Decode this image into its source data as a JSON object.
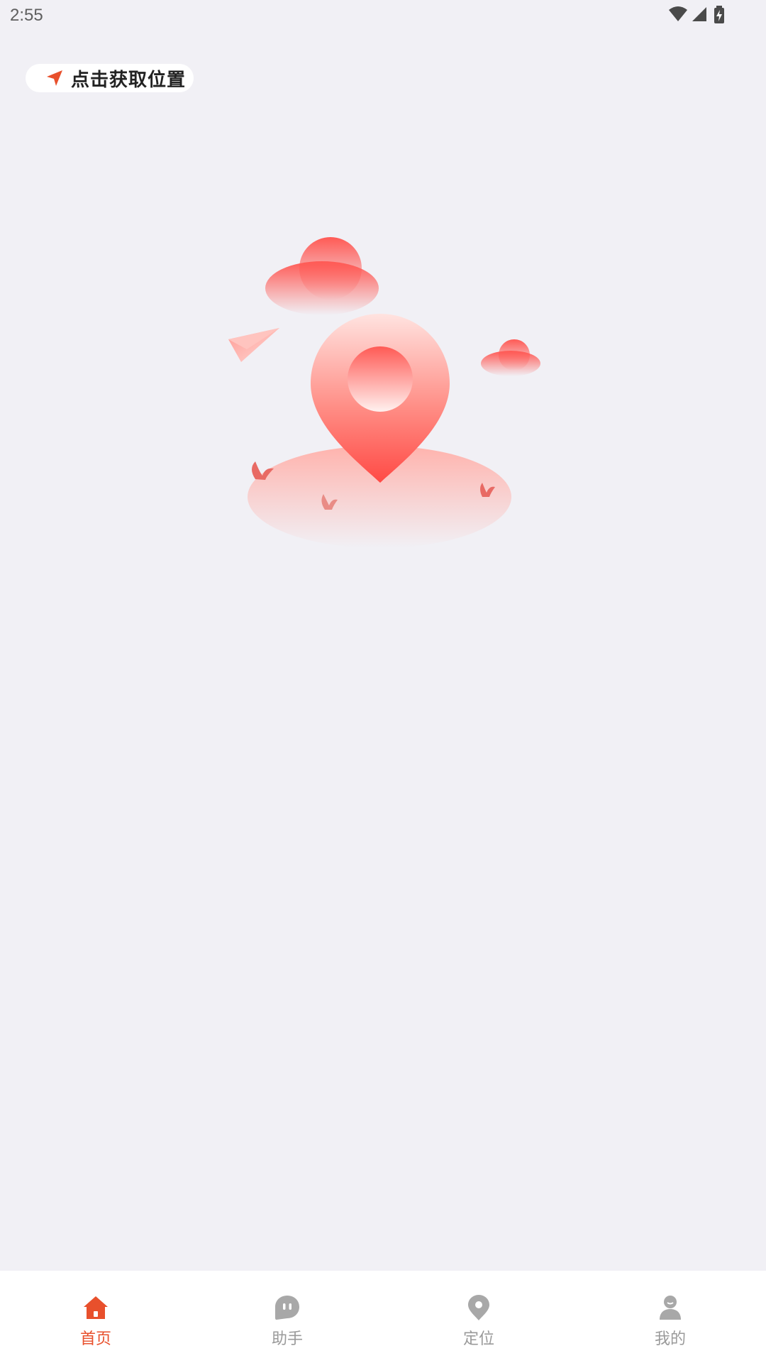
{
  "status_bar": {
    "time": "2:55"
  },
  "location": {
    "label": "点击获取位置",
    "icon": "navigation-arrow-icon"
  },
  "illustration": {
    "name": "map-pin-empty-illustration"
  },
  "bottom_nav": {
    "items": [
      {
        "label": "首页",
        "icon": "home-icon",
        "active": true
      },
      {
        "label": "助手",
        "icon": "assistant-bubble-icon",
        "active": false
      },
      {
        "label": "定位",
        "icon": "location-pin-icon",
        "active": false
      },
      {
        "label": "我的",
        "icon": "user-icon",
        "active": false
      }
    ]
  },
  "colors": {
    "background": "#f1f0f5",
    "accent": "#e8502c",
    "inactive": "#a8a8a8",
    "pin_red": "#ff5a55"
  }
}
